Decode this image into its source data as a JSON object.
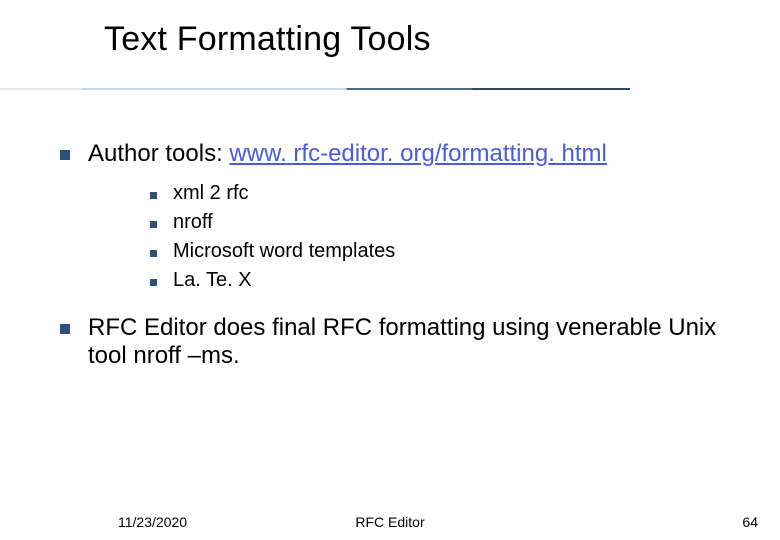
{
  "title": "Text Formatting Tools",
  "bullets": [
    {
      "prefix": "Author tools: ",
      "link": "www. rfc-editor. org/formatting. html",
      "sub": [
        "xml 2 rfc",
        "nroff",
        "Microsoft word templates",
        "La. Te. X"
      ]
    },
    {
      "text": "RFC Editor does final RFC formatting using venerable Unix tool nroff –ms."
    }
  ],
  "footer": {
    "date": "11/23/2020",
    "center": "RFC Editor",
    "page": "64"
  }
}
